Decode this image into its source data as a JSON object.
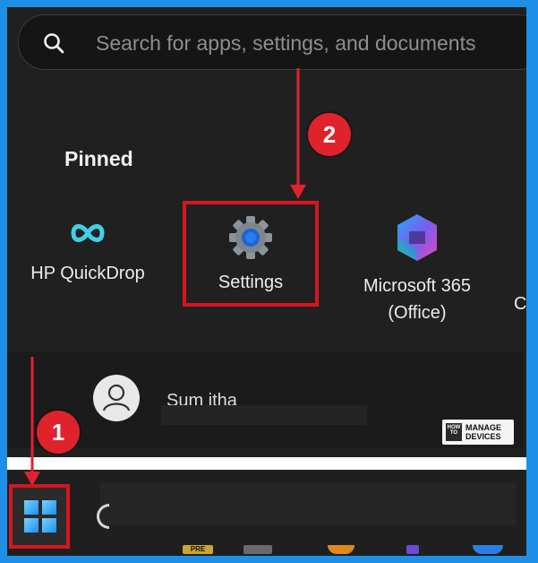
{
  "search": {
    "placeholder": "Search for apps, settings, and documents"
  },
  "pinned": {
    "title": "Pinned",
    "apps": [
      {
        "label": "HP QuickDrop"
      },
      {
        "label": "Settings"
      },
      {
        "label": "Microsoft 365",
        "label2": "(Office)"
      },
      {
        "label": "C"
      }
    ]
  },
  "user": {
    "name": "Sum itha"
  },
  "watermark": {
    "how_to": "HOW TO",
    "line1": "MANAGE",
    "line2": "DEVICES"
  },
  "annotations": {
    "step1": "1",
    "step2": "2"
  },
  "taskbar": {
    "peek_badge": "PRE"
  },
  "colors": {
    "accent": "#1e8fe6",
    "highlight": "#d7151f",
    "background": "#202020"
  }
}
